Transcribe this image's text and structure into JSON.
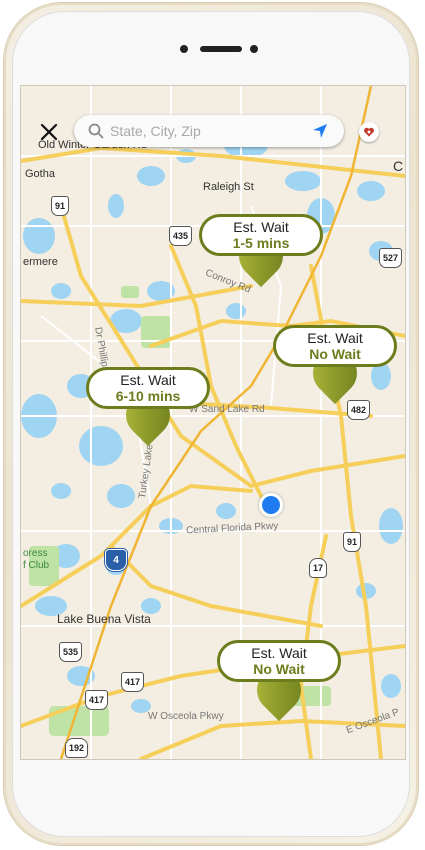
{
  "search": {
    "placeholder": "State, City, Zip"
  },
  "icons": {
    "close": "close-icon",
    "search": "search-icon",
    "location": "location-arrow-icon",
    "favorites": "heart-icon"
  },
  "colors": {
    "pin_green": "#6d7c1c",
    "user_location": "#1f7cf0",
    "road_yellow": "#f6cf5a",
    "water": "#9fd4f2",
    "park": "#bfe3a5"
  },
  "map_labels": {
    "old_winter_garden": "Old Winter Garden Rd",
    "gotha": "Gotha",
    "raleigh_st": "Raleigh St",
    "windermere": "ermere",
    "conroy_rd": "Conroy Rd",
    "dr_phillips": "Dr Phillips",
    "w_sand_lake_rd": "W Sand Lake Rd",
    "turkey_lake": "Turkey Lake",
    "central_florida_pkwy": "Central Florida Pkwy",
    "cypress_golf_club_1": "oress",
    "cypress_golf_club_2": "f Club",
    "lake_buena_vista": "Lake Buena Vista",
    "w_osceola_pkwy": "W Osceola Pkwy",
    "e_osceola_pkwy": "E Osceola P",
    "city_right": "C"
  },
  "road_shields": {
    "r91a": "91",
    "r435": "435",
    "r527": "527",
    "r482": "482",
    "r91b": "91",
    "i4": "4",
    "r17": "17",
    "r535": "535",
    "r417a": "417",
    "r417b": "417",
    "r192": "192"
  },
  "pins": [
    {
      "title": "Est. Wait",
      "wait": "1-5 mins"
    },
    {
      "title": "Est. Wait",
      "wait": "No Wait"
    },
    {
      "title": "Est. Wait",
      "wait": "6-10 mins"
    },
    {
      "title": "Est. Wait",
      "wait": "No Wait"
    }
  ]
}
